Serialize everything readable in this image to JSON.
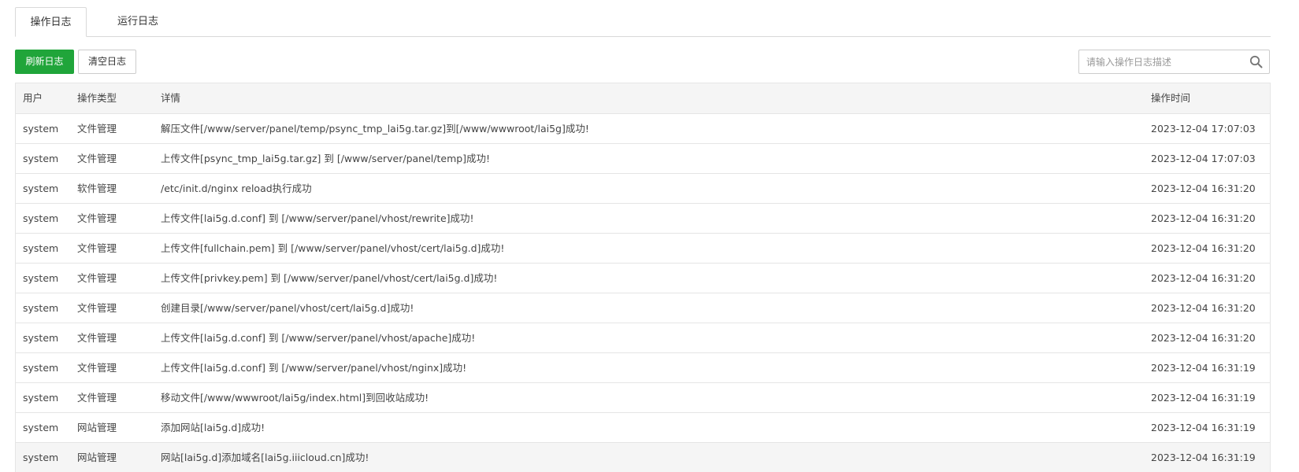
{
  "tabs": [
    {
      "label": "操作日志",
      "active": true
    },
    {
      "label": "运行日志",
      "active": false
    }
  ],
  "toolbar": {
    "refresh_label": "刷新日志",
    "clear_label": "清空日志",
    "accent_color": "#20a53a"
  },
  "search": {
    "placeholder": "请输入操作日志描述",
    "value": "",
    "icon": "search-icon"
  },
  "table": {
    "columns": [
      "用户",
      "操作类型",
      "详情",
      "操作时间"
    ],
    "rows": [
      {
        "user": "system",
        "type": "文件管理",
        "detail": "解压文件[/www/server/panel/temp/psync_tmp_lai5g.tar.gz]到[/www/wwwroot/lai5g]成功!",
        "time": "2023-12-04 17:07:03"
      },
      {
        "user": "system",
        "type": "文件管理",
        "detail": "上传文件[psync_tmp_lai5g.tar.gz] 到 [/www/server/panel/temp]成功!",
        "time": "2023-12-04 17:07:03"
      },
      {
        "user": "system",
        "type": "软件管理",
        "detail": "/etc/init.d/nginx reload执行成功",
        "time": "2023-12-04 16:31:20"
      },
      {
        "user": "system",
        "type": "文件管理",
        "detail": "上传文件[lai5g.d.conf] 到 [/www/server/panel/vhost/rewrite]成功!",
        "time": "2023-12-04 16:31:20"
      },
      {
        "user": "system",
        "type": "文件管理",
        "detail": "上传文件[fullchain.pem] 到 [/www/server/panel/vhost/cert/lai5g.d]成功!",
        "time": "2023-12-04 16:31:20"
      },
      {
        "user": "system",
        "type": "文件管理",
        "detail": "上传文件[privkey.pem] 到 [/www/server/panel/vhost/cert/lai5g.d]成功!",
        "time": "2023-12-04 16:31:20"
      },
      {
        "user": "system",
        "type": "文件管理",
        "detail": "创建目录[/www/server/panel/vhost/cert/lai5g.d]成功!",
        "time": "2023-12-04 16:31:20"
      },
      {
        "user": "system",
        "type": "文件管理",
        "detail": "上传文件[lai5g.d.conf] 到 [/www/server/panel/vhost/apache]成功!",
        "time": "2023-12-04 16:31:20"
      },
      {
        "user": "system",
        "type": "文件管理",
        "detail": "上传文件[lai5g.d.conf] 到 [/www/server/panel/vhost/nginx]成功!",
        "time": "2023-12-04 16:31:19"
      },
      {
        "user": "system",
        "type": "文件管理",
        "detail": "移动文件[/www/wwwroot/lai5g/index.html]到回收站成功!",
        "time": "2023-12-04 16:31:19"
      },
      {
        "user": "system",
        "type": "网站管理",
        "detail": "添加网站[lai5g.d]成功!",
        "time": "2023-12-04 16:31:19"
      },
      {
        "user": "system",
        "type": "网站管理",
        "detail": "网站[lai5g.d]添加域名[lai5g.iiicloud.cn]成功!",
        "time": "2023-12-04 16:31:19"
      }
    ]
  }
}
